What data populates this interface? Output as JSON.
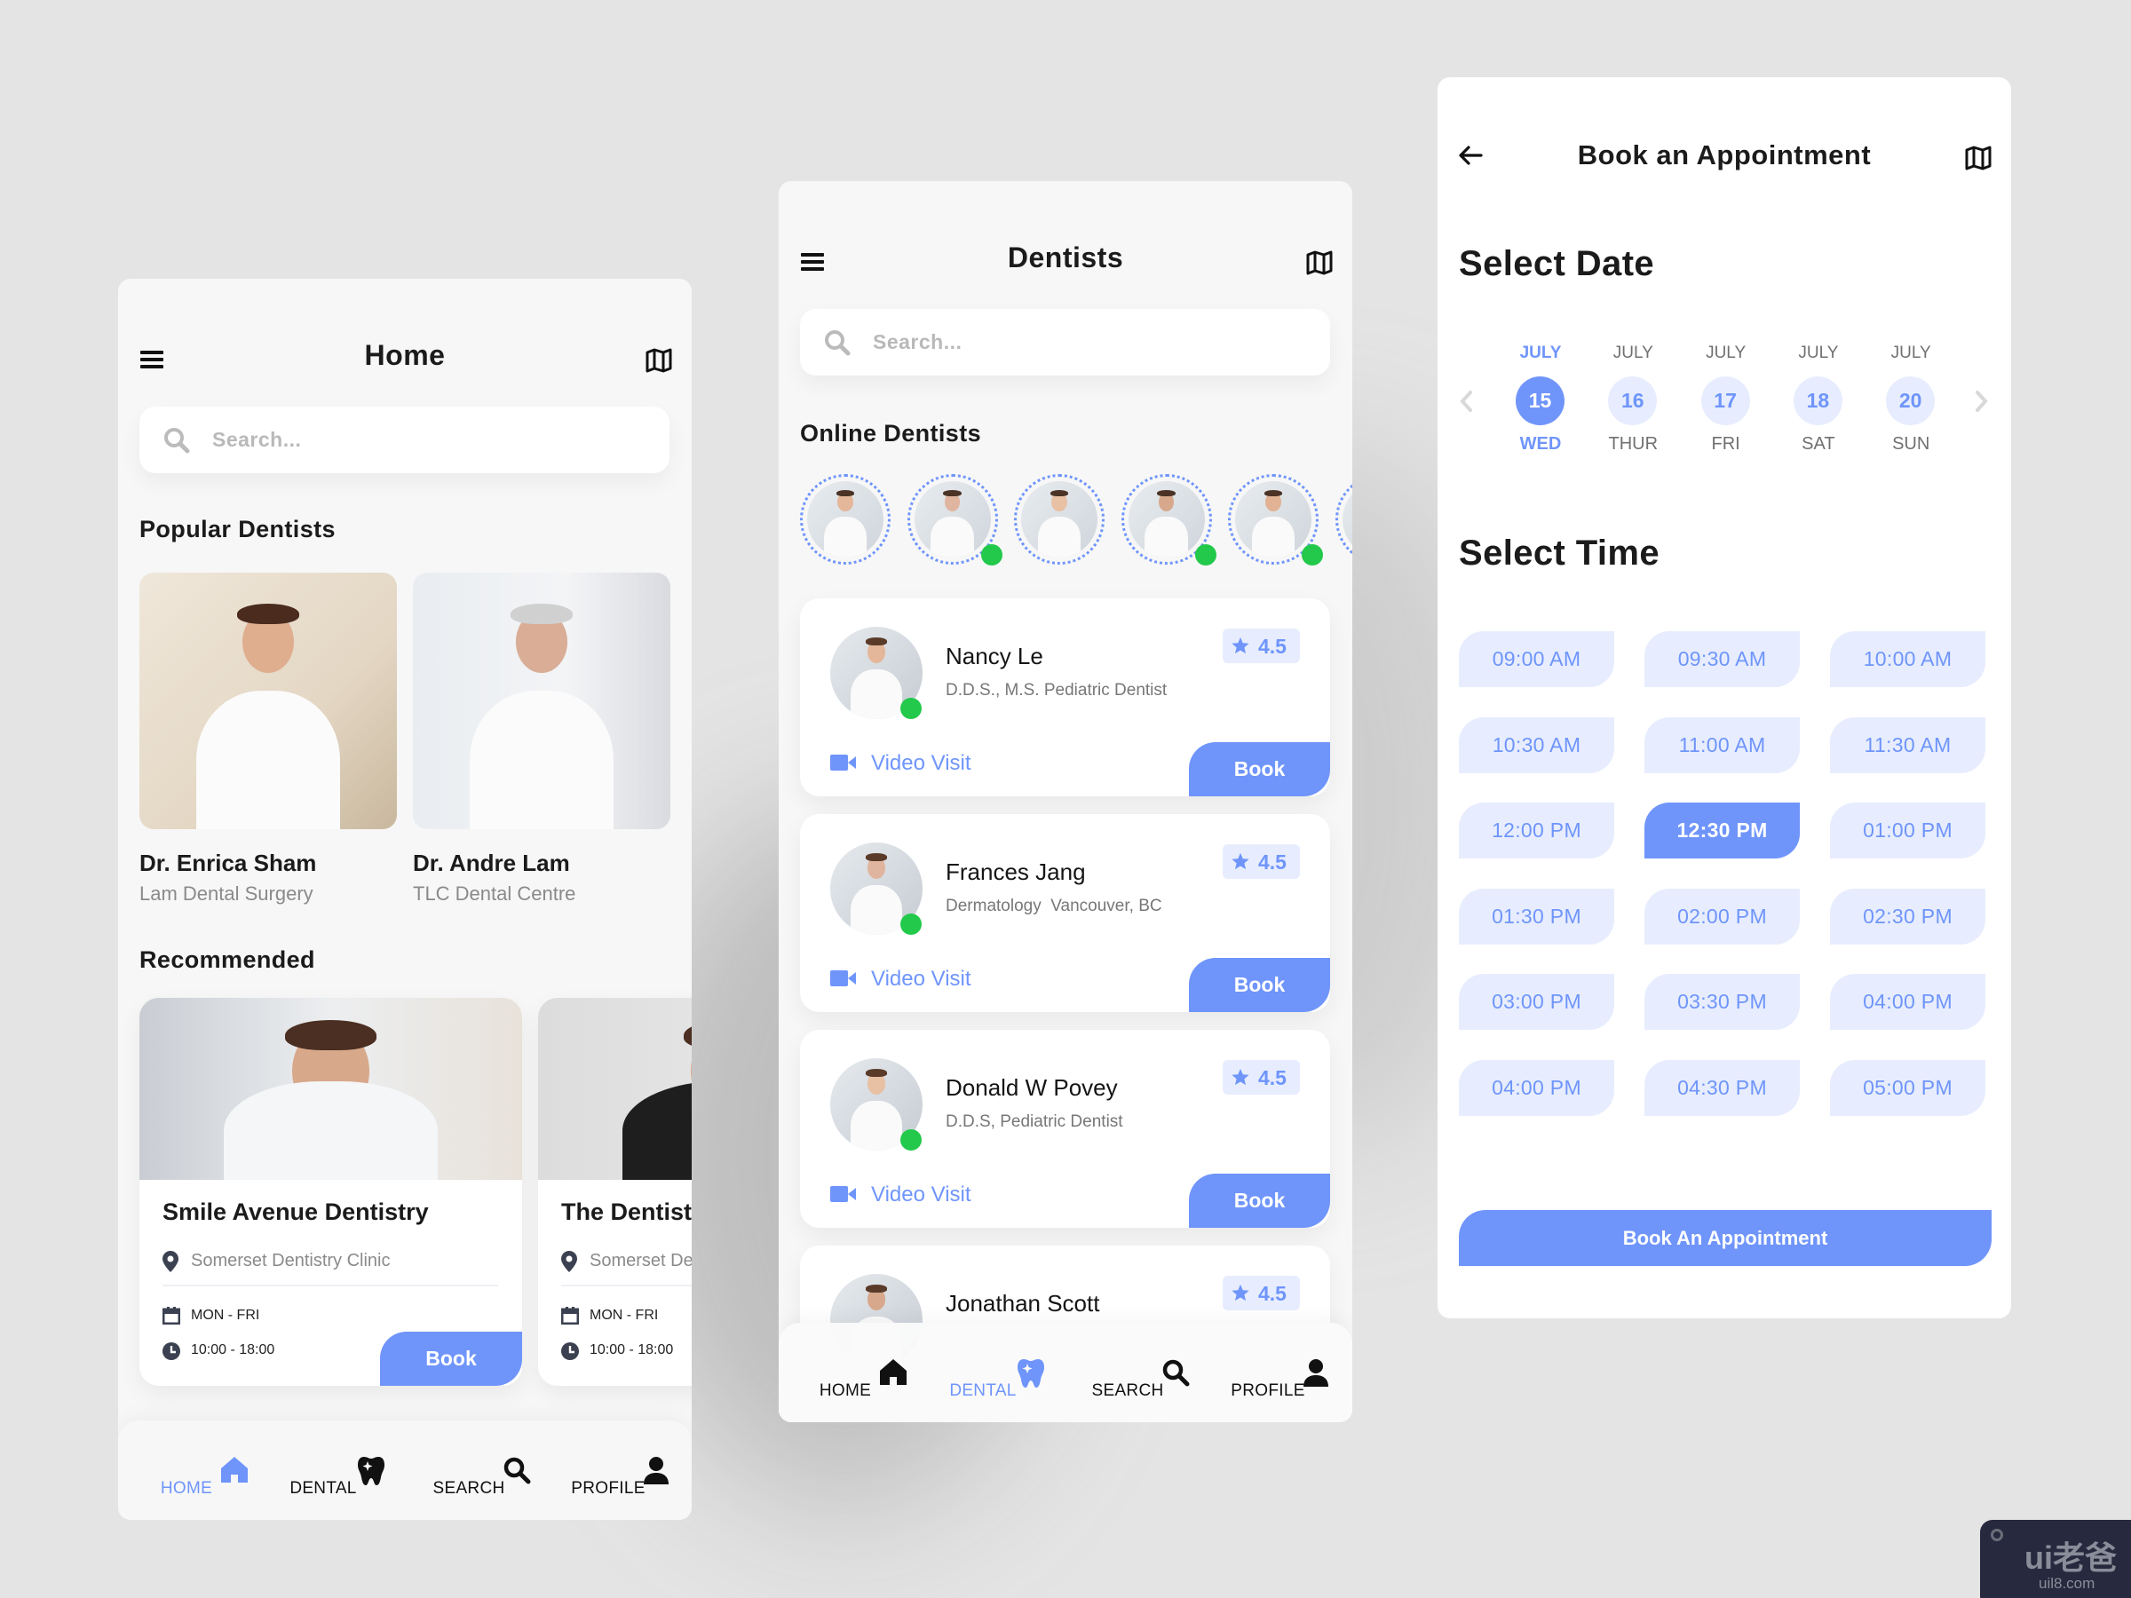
{
  "colors": {
    "accent": "#6f95fb",
    "accent_light": "#e7edfe",
    "online": "#22c94b",
    "background": "#e4e4e4"
  },
  "home": {
    "title": "Home",
    "search_placeholder": "Search...",
    "popular_heading": "Popular Dentists",
    "popular": [
      {
        "name": "Dr. Enrica Sham",
        "clinic": "Lam Dental Surgery"
      },
      {
        "name": "Dr. Andre Lam",
        "clinic": "TLC Dental Centre"
      }
    ],
    "recommended_heading": "Recommended",
    "recommended": [
      {
        "name": "Smile Avenue Dentistry",
        "location": "Somerset Dentistry Clinic",
        "days": "MON - FRI",
        "hours": "10:00 - 18:00",
        "book_label": "Book"
      },
      {
        "name": "The Dentist (",
        "location": "Somerset De",
        "days": "MON - FRI",
        "hours": "10:00 - 18:00"
      }
    ],
    "nav": [
      {
        "label": "HOME",
        "icon": "home-icon",
        "active": true
      },
      {
        "label": "DENTAL",
        "icon": "tooth-icon",
        "active": false
      },
      {
        "label": "SEARCH",
        "icon": "search-icon",
        "active": false
      },
      {
        "label": "PROFILE",
        "icon": "user-icon",
        "active": false
      }
    ]
  },
  "dentists": {
    "title": "Dentists",
    "search_placeholder": "Search...",
    "online_heading": "Online Dentists",
    "online": [
      {
        "online": false
      },
      {
        "online": true
      },
      {
        "online": false
      },
      {
        "online": true
      },
      {
        "online": true
      },
      {
        "online": false
      }
    ],
    "list": [
      {
        "name": "Nancy Le",
        "specialty": "D.D.S., M.S. Pediatric Dentist",
        "rating": "4.5",
        "video_label": "Video Visit",
        "book_label": "Book",
        "online": true
      },
      {
        "name": "Frances Jang",
        "specialty": "Dermatology  Vancouver, BC",
        "rating": "4.5",
        "video_label": "Video Visit",
        "book_label": "Book",
        "online": true
      },
      {
        "name": "Donald W Povey",
        "specialty": "D.D.S, Pediatric Dentist",
        "rating": "4.5",
        "video_label": "Video Visit",
        "book_label": "Book",
        "online": true
      },
      {
        "name": "Jonathan Scott",
        "rating": "4.5"
      }
    ],
    "nav": [
      {
        "label": "HOME",
        "icon": "home-icon",
        "active": false
      },
      {
        "label": "DENTAL",
        "icon": "tooth-icon",
        "active": true
      },
      {
        "label": "SEARCH",
        "icon": "search-icon",
        "active": false
      },
      {
        "label": "PROFILE",
        "icon": "user-icon",
        "active": false
      }
    ]
  },
  "booking": {
    "title": "Book an Appointment",
    "date_heading": "Select Date",
    "dates": [
      {
        "month": "JULY",
        "day": "15",
        "weekday": "WED",
        "selected": true
      },
      {
        "month": "JULY",
        "day": "16",
        "weekday": "THUR",
        "selected": false
      },
      {
        "month": "JULY",
        "day": "17",
        "weekday": "FRI",
        "selected": false
      },
      {
        "month": "JULY",
        "day": "18",
        "weekday": "SAT",
        "selected": false
      },
      {
        "month": "JULY",
        "day": "20",
        "weekday": "SUN",
        "selected": false
      }
    ],
    "time_heading": "Select Time",
    "times": [
      "09:00 AM",
      "09:30 AM",
      "10:00 AM",
      "10:30 AM",
      "11:00 AM",
      "11:30 AM",
      "12:00 PM",
      "12:30 PM",
      "01:00 PM",
      "01:30 PM",
      "02:00 PM",
      "02:30 PM",
      "03:00 PM",
      "03:30 PM",
      "04:00 PM",
      "04:00 PM",
      "04:30 PM",
      "05:00 PM"
    ],
    "selected_time": "12:30 PM",
    "submit_label": "Book An Appointment"
  },
  "watermark": {
    "brand": "ui老爸",
    "url": "uil8.com"
  }
}
